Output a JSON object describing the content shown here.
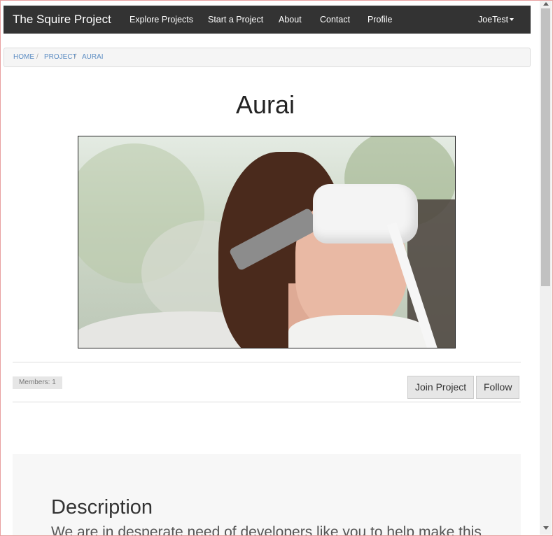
{
  "navbar": {
    "brand": "The Squire Project",
    "items": [
      {
        "label": "Explore Projects"
      },
      {
        "label": "Start a Project"
      },
      {
        "label": "About"
      },
      {
        "label": "Contact"
      },
      {
        "label": "Profile"
      }
    ],
    "user": "JoeTest"
  },
  "breadcrumb": [
    "HOME",
    "PROJECT",
    "AURAI"
  ],
  "breadcrumb_separator": "/",
  "project": {
    "title": "Aurai",
    "members_label": "Members: 1",
    "join_label": "Join Project",
    "follow_label": "Follow"
  },
  "description": {
    "heading": "Description",
    "text": "We are in desperate need of developers like you to help make this"
  },
  "colors": {
    "navbar_bg": "#333333",
    "breadcrumb_link": "#5b8cc2",
    "button_bg": "#e6e6e6",
    "panel_bg": "#f7f7f7"
  },
  "icons": {
    "user_dropdown": "caret-down-icon",
    "scroll_up": "arrow-up-icon",
    "scroll_down": "arrow-down-icon"
  }
}
